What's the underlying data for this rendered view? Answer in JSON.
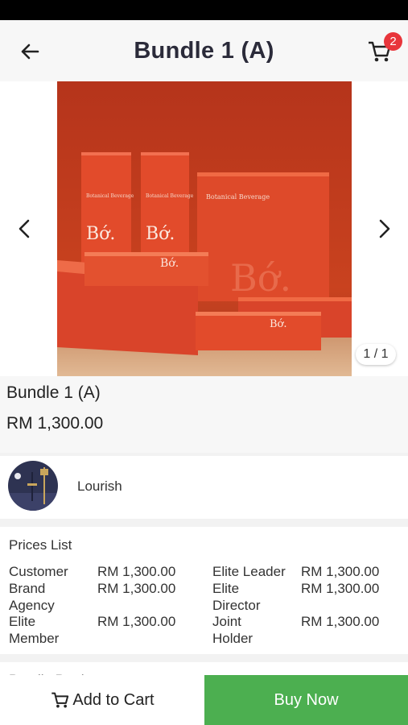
{
  "header": {
    "title": "Bundle 1 (A)",
    "back_icon": "arrow-left-icon",
    "cart_icon": "cart-icon",
    "cart_count": "2"
  },
  "gallery": {
    "page_counter": "1 / 1",
    "prev_icon": "chevron-left-icon",
    "next_icon": "chevron-right-icon",
    "image_brand_text": "Bớ.",
    "image_box_text": "Botanical Beverage"
  },
  "product": {
    "name": "Bundle 1 (A)",
    "price": "RM 1,300.00"
  },
  "seller": {
    "name": "Lourish"
  },
  "prices_list": {
    "title": "Prices List",
    "items": [
      {
        "label": "Customer",
        "value": "RM 1,300.00"
      },
      {
        "label": "Brand Agency",
        "value": "RM 1,300.00"
      },
      {
        "label": "Elite Member",
        "value": "RM 1,300.00"
      },
      {
        "label": "Elite Leader",
        "value": "RM 1,300.00"
      },
      {
        "label": "Elite Director",
        "value": "RM 1,300.00"
      },
      {
        "label": "Joint Holder",
        "value": "RM 1,300.00"
      }
    ]
  },
  "next_section": {
    "title": "Bundle Products"
  },
  "actions": {
    "add_to_cart": "Add to Cart",
    "buy_now": "Buy Now"
  },
  "colors": {
    "buy_now": "#4caf50",
    "badge": "#e8353b",
    "product_orange": "#d8452a"
  }
}
